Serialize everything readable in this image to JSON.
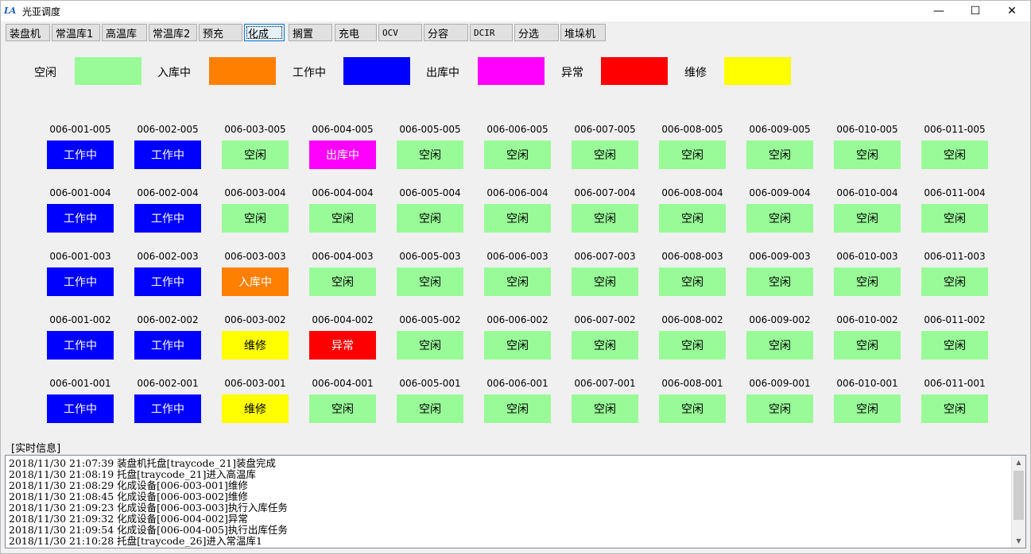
{
  "window": {
    "title": "光亚调度",
    "icon": "LA",
    "controls": {
      "minimize": "—",
      "maximize": "☐",
      "close": "✕"
    }
  },
  "toolbar": [
    {
      "label": "装盘机",
      "mono": false,
      "active": false
    },
    {
      "label": "常温库1",
      "mono": false,
      "active": false
    },
    {
      "label": "高温库",
      "mono": false,
      "active": false
    },
    {
      "label": "常温库2",
      "mono": false,
      "active": false
    },
    {
      "label": "预充",
      "mono": false,
      "active": false
    },
    {
      "label": "化成",
      "mono": false,
      "active": true
    },
    {
      "label": "搁置",
      "mono": false,
      "active": false
    },
    {
      "label": "充电",
      "mono": false,
      "active": false
    },
    {
      "label": "OCV",
      "mono": true,
      "active": false
    },
    {
      "label": "分容",
      "mono": false,
      "active": false
    },
    {
      "label": "DCIR",
      "mono": true,
      "active": false
    },
    {
      "label": "分选",
      "mono": false,
      "active": false
    },
    {
      "label": "堆垛机",
      "mono": false,
      "active": false
    }
  ],
  "status_colors": {
    "空闲": "#98fb98",
    "入库中": "#ff8000",
    "工作中": "#0000ff",
    "出库中": "#ff00ff",
    "异常": "#ff0000",
    "维修": "#ffff00"
  },
  "status_text_colors": {
    "空闲": "#000000",
    "入库中": "#ffffff",
    "工作中": "#ffffff",
    "出库中": "#ffffff",
    "异常": "#ffffff",
    "维修": "#000000"
  },
  "legend": [
    "空闲",
    "入库中",
    "工作中",
    "出库中",
    "异常",
    "维修"
  ],
  "grid": {
    "rows": [
      {
        "level": "005",
        "statuses": [
          "工作中",
          "工作中",
          "空闲",
          "出库中",
          "空闲",
          "空闲",
          "空闲",
          "空闲",
          "空闲",
          "空闲",
          "空闲"
        ]
      },
      {
        "level": "004",
        "statuses": [
          "工作中",
          "工作中",
          "空闲",
          "空闲",
          "空闲",
          "空闲",
          "空闲",
          "空闲",
          "空闲",
          "空闲",
          "空闲"
        ]
      },
      {
        "level": "003",
        "statuses": [
          "工作中",
          "工作中",
          "入库中",
          "空闲",
          "空闲",
          "空闲",
          "空闲",
          "空闲",
          "空闲",
          "空闲",
          "空闲"
        ]
      },
      {
        "level": "002",
        "statuses": [
          "工作中",
          "工作中",
          "维修",
          "异常",
          "空闲",
          "空闲",
          "空闲",
          "空闲",
          "空闲",
          "空闲",
          "空闲"
        ]
      },
      {
        "level": "001",
        "statuses": [
          "工作中",
          "工作中",
          "维修",
          "空闲",
          "空闲",
          "空闲",
          "空闲",
          "空闲",
          "空闲",
          "空闲",
          "空闲"
        ]
      }
    ],
    "columns": [
      "001",
      "002",
      "003",
      "004",
      "005",
      "006",
      "007",
      "008",
      "009",
      "010",
      "011"
    ],
    "prefix": "006"
  },
  "info": {
    "label": "[实时信息]",
    "lines": [
      "2018/11/30  21:07:39 装盘机托盘[traycode_21]装盘完成",
      "2018/11/30  21:08:19 托盘[traycode_21]进入高温库",
      "2018/11/30  21:08:29 化成设备[006-003-001]维修",
      "2018/11/30  21:08:45 化成设备[006-003-002]维修",
      "2018/11/30  21:09:23 化成设备[006-003-003]执行入库任务",
      "2018/11/30  21:09:32 化成设备[006-004-002]异常",
      "2018/11/30  21:09:54 化成设备[006-004-005]执行出库任务",
      "2018/11/30  21:10:28 托盘[traycode_26]进入常温库1"
    ]
  }
}
